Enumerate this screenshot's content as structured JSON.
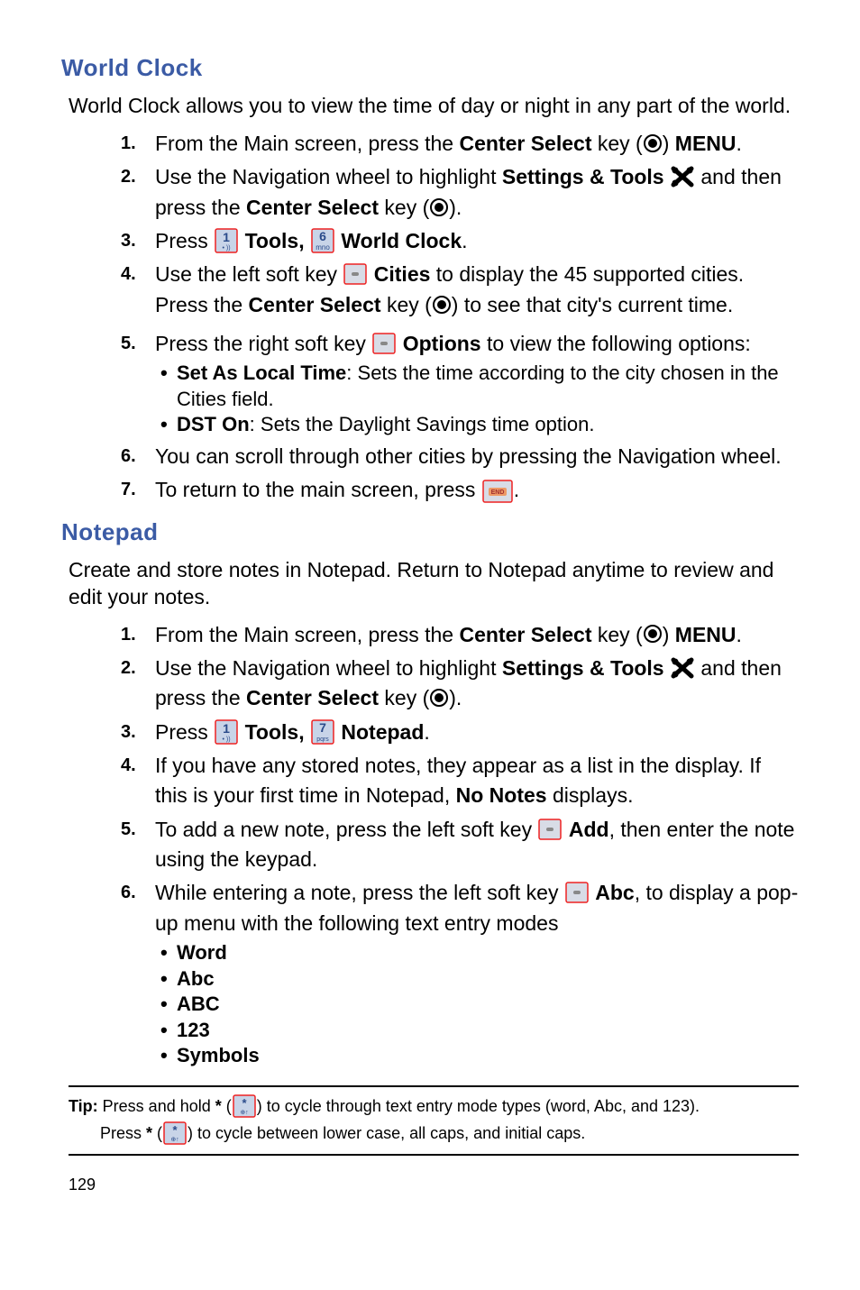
{
  "sections": {
    "worldClock": {
      "heading": "World Clock",
      "intro": "World Clock allows you to view the time of day or night in any part of the world.",
      "steps": {
        "s1_a": "From the Main screen, press the ",
        "s1_b": "Center Select",
        "s1_c": " key (",
        "s1_d": ") ",
        "s1_e": "MENU",
        "s1_f": ".",
        "s2_a": "Use the Navigation wheel to highlight ",
        "s2_b": "Settings & Tools",
        "s2_c": " and then press the ",
        "s2_d": "Center Select",
        "s2_e": " key (",
        "s2_f": ").",
        "s3_a": "Press ",
        "s3_b": "Tools,",
        "s3_c": "World Clock",
        "s3_d": ".",
        "s4_a": "Use the left soft key ",
        "s4_b": "Cities",
        "s4_c": " to display the 45 supported cities. Press the ",
        "s4_d": "Center Select",
        "s4_e": " key (",
        "s4_f": ") to see that city's current time.",
        "s5_a": "Press the right soft key ",
        "s5_b": "Options",
        "s5_c": " to view the following options:",
        "s5_bullet1_label": "Set As Local Time",
        "s5_bullet1_text": ": Sets the time according to the city chosen in the Cities field.",
        "s5_bullet2_label": "DST On",
        "s5_bullet2_text": ": Sets the Daylight Savings time option.",
        "s6": "You can scroll through other cities by pressing the Navigation wheel.",
        "s7_a": "To return to the main screen, press ",
        "s7_b": "."
      }
    },
    "notepad": {
      "heading": "Notepad",
      "intro": "Create and store notes in Notepad. Return to Notepad anytime to review and edit your notes.",
      "steps": {
        "s1_a": "From the Main screen, press the ",
        "s1_b": "Center Select",
        "s1_c": " key (",
        "s1_d": ") ",
        "s1_e": "MENU",
        "s1_f": ".",
        "s2_a": "Use the Navigation wheel to highlight ",
        "s2_b": "Settings & Tools",
        "s2_c": " and then press the ",
        "s2_d": "Center Select",
        "s2_e": " key (",
        "s2_f": ").",
        "s3_a": "Press ",
        "s3_b": "Tools,",
        "s3_c": "Notepad",
        "s3_d": ".",
        "s4_a": "If you have any stored notes, they appear as a list in the display. If this is your first time in Notepad, ",
        "s4_b": "No Notes",
        "s4_c": " displays.",
        "s5_a": "To add a new note, press the left soft key ",
        "s5_b": "Add",
        "s5_c": ", then enter the note using the keypad.",
        "s6_a": "While entering a note, press the left soft key ",
        "s6_b": "Abc",
        "s6_c": ", to display a pop-up menu with the following text entry modes",
        "b1": "Word",
        "b2": "Abc",
        "b3": "ABC",
        "b4": "123",
        "b5": "Symbols"
      }
    }
  },
  "listNums": {
    "n1": "1.",
    "n2": "2.",
    "n3": "3.",
    "n4": "4.",
    "n5": "5.",
    "n6": "6.",
    "n7": "7."
  },
  "tip": {
    "label": "Tip:",
    "line1_a": " Press and hold ",
    "line1_b": "*",
    "line1_c": " (",
    "line1_d": ") to cycle through text entry mode types (word, Abc, and 123).",
    "line2_a": "Press ",
    "line2_b": "*",
    "line2_c": " (",
    "line2_d": ") to cycle between lower case, all caps, and initial caps."
  },
  "pageNum": "129"
}
